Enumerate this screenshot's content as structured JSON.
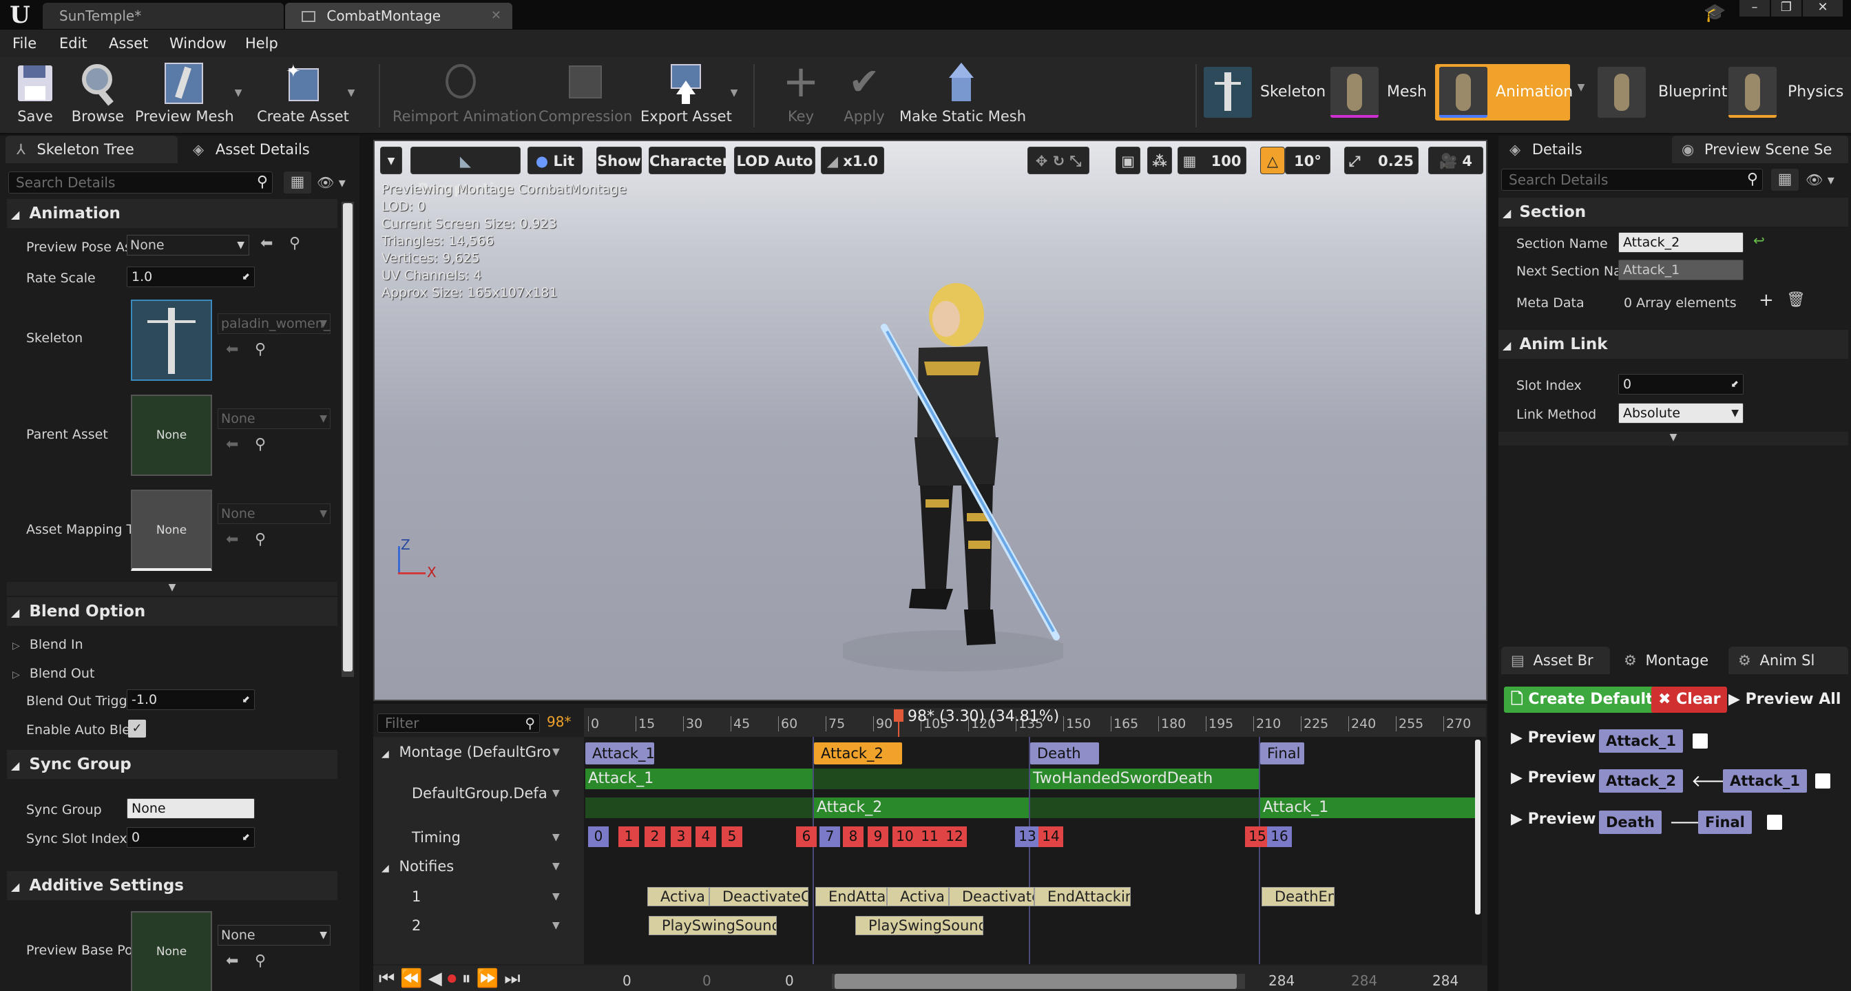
{
  "tabs": {
    "doc1": "SunTemple*",
    "doc2": "CombatMontage"
  },
  "window_buttons": {
    "minimize": "–",
    "maximize": "❐",
    "close": "✕"
  },
  "menus": [
    "File",
    "Edit",
    "Asset",
    "Window",
    "Help"
  ],
  "toolbar": {
    "save": "Save",
    "browse": "Browse",
    "preview_mesh": "Preview Mesh",
    "create_asset": "Create Asset",
    "reimport": "Reimport Animation",
    "compression": "Compression",
    "export": "Export Asset",
    "key": "Key",
    "apply": "Apply",
    "static_mesh": "Make Static Mesh"
  },
  "modes": {
    "skeleton": "Skeleton",
    "mesh": "Mesh",
    "animation": "Animation",
    "blueprint": "Blueprint",
    "physics": "Physics"
  },
  "left": {
    "tab1": "Skeleton Tree",
    "tab2": "Asset Details",
    "search_placeholder": "Search Details",
    "animation_cat": "Animation",
    "preview_pose_label": "Preview Pose As",
    "preview_pose_value": "None",
    "rate_scale_label": "Rate Scale",
    "rate_scale_value": "1.0",
    "skeleton_label": "Skeleton",
    "skeleton_value": "paladin_women_",
    "parent_label": "Parent Asset",
    "parent_thumb": "None",
    "parent_value": "None",
    "mapping_label": "Asset Mapping T",
    "mapping_thumb": "None",
    "mapping_value": "None",
    "blend_cat": "Blend Option",
    "blend_in": "Blend In",
    "blend_out": "Blend Out",
    "blend_trigger_label": "Blend Out Trigge",
    "blend_trigger_value": "-1.0",
    "auto_blend_label": "Enable Auto Bler",
    "sync_cat": "Sync Group",
    "sync_group_label": "Sync Group",
    "sync_group_value": "None",
    "sync_slot_label": "Sync Slot Index",
    "sync_slot_value": "0",
    "additive_cat": "Additive Settings",
    "base_pose_label": "Preview Base Po",
    "base_pose_thumb": "None",
    "base_pose_value": "None"
  },
  "viewport": {
    "perspective": "Perspective",
    "lit": "Lit",
    "show": "Show",
    "character": "Character",
    "lod": "LOD Auto",
    "speed": "x1.0",
    "grid_value": "100",
    "angle_value": "10°",
    "scale_value": "0.25",
    "cam_speed": "4",
    "stats": [
      "Previewing Montage CombatMontage",
      "LOD: 0",
      "Current Screen Size: 0.923",
      "Triangles: 14,566",
      "Vertices: 9,625",
      "UV Channels: 4",
      "Approx Size: 165x107x181"
    ],
    "axis_z": "Z",
    "axis_x": "X"
  },
  "timeline": {
    "filter_placeholder": "Filter",
    "frame_marker": "98*",
    "playhead_label": "98* (3.30) (34.81%)",
    "ruler": [
      "0",
      "15",
      "30",
      "45",
      "60",
      "75",
      "90",
      "105",
      "120",
      "135",
      "150",
      "165",
      "180",
      "195",
      "210",
      "225",
      "240",
      "255",
      "270"
    ],
    "montage_track": "Montage (DefaultGro",
    "slot_track": "DefaultGroup.Defa",
    "timing_track": "Timing",
    "notifies_track": "Notifies",
    "notify_row1": "1",
    "notify_row2": "2",
    "sections": [
      "Attack_1",
      "Attack_2",
      "Death",
      "Final"
    ],
    "slot_row1": [
      "Attack_1",
      "TwoHandedSwordDeath"
    ],
    "slot_row2": [
      "Attack_2",
      "Attack_1"
    ],
    "timing_numbers": [
      "0",
      "1",
      "2",
      "3",
      "4",
      "5",
      "6",
      "7",
      "8",
      "9",
      "10",
      "11",
      "12",
      "13",
      "14",
      "15",
      "16"
    ],
    "notifies_row1": [
      "Activa",
      "DeactivateC",
      "EndAtta",
      "Activa",
      "Deactivate",
      "EndAttacking",
      "DeathEnd"
    ],
    "notifies_row2": [
      "PlaySwingSound",
      "PlaySwingSound"
    ],
    "transport_values": [
      "0",
      "0",
      "0",
      "284",
      "284",
      "284"
    ]
  },
  "right": {
    "tab1": "Details",
    "tab2": "Preview Scene Se",
    "search_placeholder": "Search Details",
    "section_cat": "Section",
    "section_name_label": "Section Name",
    "section_name_value": "Attack_2",
    "next_section_label": "Next Section Na",
    "next_section_value": "Attack_1",
    "meta_label": "Meta Data",
    "meta_value": "0 Array elements",
    "anim_link_cat": "Anim Link",
    "slot_index_label": "Slot Index",
    "slot_index_value": "0",
    "link_method_label": "Link Method",
    "link_method_value": "Absolute",
    "btab1": "Asset Br",
    "btab2": "Montage",
    "btab3": "Anim Sl",
    "create_default": "Create Default",
    "clear": "Clear",
    "preview_all": "Preview All",
    "preview": "Preview",
    "row1": [
      "Attack_1"
    ],
    "row2": [
      "Attack_2",
      "Attack_1"
    ],
    "row3": [
      "Death",
      "Final"
    ]
  },
  "colors": {
    "accent_orange": "#f0a22a",
    "section_purple": "#8e8ec8",
    "slot_green": "#2a8a2a",
    "timing_red": "#e04444",
    "timing_purple": "#7a7ac8",
    "create_green": "#3da83d",
    "clear_red": "#d03030"
  }
}
